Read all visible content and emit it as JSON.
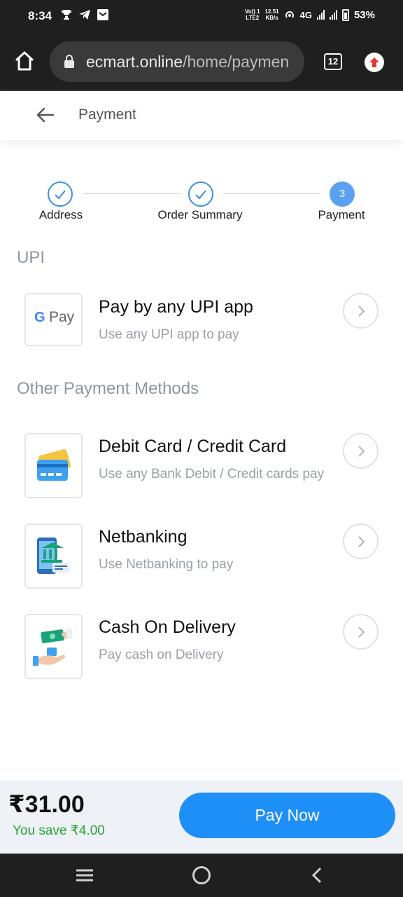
{
  "status_bar": {
    "time": "8:34",
    "network_top": "Vo)) 1",
    "network_bottom": "LTE2",
    "speed_top": "12.51",
    "speed_bottom": "KB/s",
    "network_type": "4G",
    "battery": "53%"
  },
  "browser": {
    "url_domain": "ecmart.online",
    "url_path": "/home/paymen",
    "tab_count": "12"
  },
  "header": {
    "title": "Payment"
  },
  "stepper": {
    "steps": [
      {
        "label": "Address",
        "state": "done"
      },
      {
        "label": "Order Summary",
        "state": "done"
      },
      {
        "label": "Payment",
        "state": "active",
        "number": "3"
      }
    ]
  },
  "sections": {
    "upi_title": "UPI",
    "other_title": "Other Payment Methods"
  },
  "methods": [
    {
      "icon": "gpay-icon",
      "title": "Pay by any UPI app",
      "subtitle": "Use any UPI app to pay",
      "icon_text_g": "G",
      "icon_text_pay": "Pay"
    },
    {
      "icon": "credit-card-icon",
      "title": "Debit Card / Credit Card",
      "subtitle": "Use any Bank Debit / Credit cards pay"
    },
    {
      "icon": "netbanking-icon",
      "title": "Netbanking",
      "subtitle": "Use Netbanking to pay"
    },
    {
      "icon": "cash-on-delivery-icon",
      "title": "Cash On Delivery",
      "subtitle": "Pay cash on Delivery"
    }
  ],
  "footer": {
    "price": "₹31.00",
    "savings": "You save ₹4.00",
    "pay_button": "Pay Now"
  },
  "colors": {
    "accent": "#1e8ff7",
    "savings_green": "#23a338",
    "step_blue": "#3a8ee6"
  }
}
